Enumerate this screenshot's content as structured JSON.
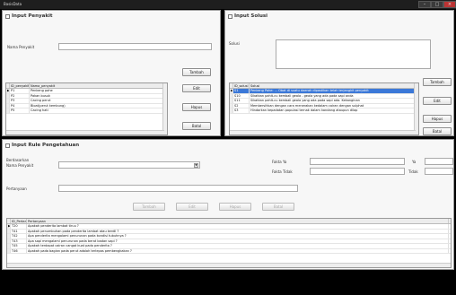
{
  "window": {
    "title": "BasisData"
  },
  "left_panel": {
    "title": "Input Penyakit",
    "name_label": "Nama Penyakit",
    "tambah_label": "Tambah",
    "edit_label": "Edit",
    "hapus_label": "Hapus",
    "batal_label": "Batal",
    "table": {
      "columns": [
        "ID_penyakit",
        "Nama_penyakit"
      ],
      "rows": [
        [
          "P1",
          "Penkeng pahe"
        ],
        [
          "P2",
          "Pakan busuk"
        ],
        [
          "P3",
          "Cacing perut"
        ],
        [
          "P4",
          "Bloat(perut kembung)"
        ],
        [
          "P5",
          "Cacing hati"
        ]
      ]
    }
  },
  "right_panel": {
    "title": "Input Solusi",
    "solusi_label": "Solusi",
    "tambah_label": "Tambah",
    "edit_label": "Edit",
    "hapus_label": "Hapus",
    "batal_label": "Batal",
    "table": {
      "columns": [
        "ID_solusi",
        "Solusi"
      ],
      "rows": [
        [
          "S1",
          "Penkeng Pahe: ... Obat di suatu daerah dipastikan telah terjangkit penyakit"
        ],
        [
          "S10",
          "Sikatkan pahit-cu kembali geala - geala yang ada pada sapi anda"
        ],
        [
          "S11",
          "Sikatkan pahit-cu kembali geala yang ada pada sapi ada. Kekanginan"
        ],
        [
          "S2",
          "Membersihkan dengan cara menerakan kedalam cairan dengan sulphat"
        ],
        [
          "S3",
          "Hindarkan kepadatan populasi ternak dalam kandang ataupun dilap"
        ]
      ]
    }
  },
  "bottom_panel": {
    "title": "Input Rule Pengetahuan",
    "berdasarkan_label": "Berdasarkan",
    "nama_penyakit_label": "Nama Penyakit",
    "pertanyaan_label": "Pertanyaan",
    "fakta_ya_label": "Fakta Ya",
    "fakta_tidak_label": "Fakta Tidak",
    "ya_label": "Ya",
    "tidak_label": "Tidak",
    "tambah_label": "Tambah",
    "edit_label": "Edit",
    "hapus_label": "Hapus",
    "batal_label": "Batal",
    "table": {
      "columns": [
        "ID_Pertanyaan",
        "Pertanyaan"
      ],
      "rows": [
        [
          "T20",
          "Apakah penderita lambat tiruu ?"
        ],
        [
          "T41",
          "Apakah penumbuhan pada penderita lambat atau kerdil ?"
        ],
        [
          "T42",
          "Apa penderita mengalami penurunan pada kondisi tubuhnya ?"
        ],
        [
          "T43",
          "Apa sapi mengalami penurunan pada berat badan sapi ?"
        ],
        [
          "T45",
          "Apakah terdapat cairan cangat kuat pada penderita ?"
        ],
        [
          "T46",
          "Apakah pada bagian pada perut adalah terlepas pembengkakan ?"
        ]
      ]
    }
  },
  "icons": {
    "dropdown": "chevron-down-icon",
    "row_pointer": "pointer-icon",
    "close": "close-icon"
  },
  "colors": {
    "background": "#000000",
    "panel": "#f7f7f7",
    "selection": "#3b78d8"
  }
}
